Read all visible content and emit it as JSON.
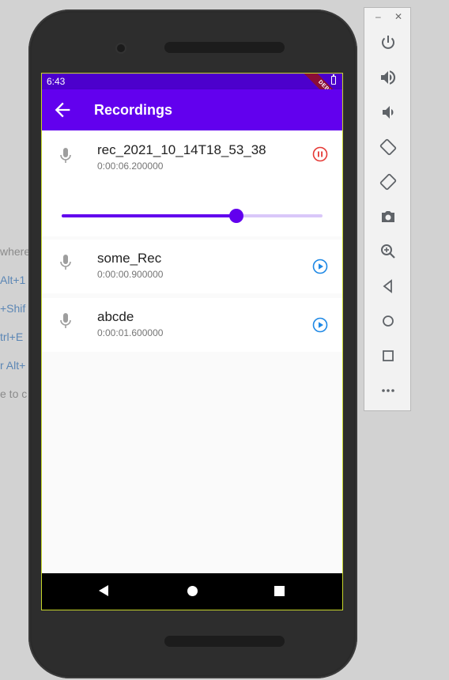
{
  "background_hints": [
    "where",
    "Alt+1",
    "+Shif",
    "trl+E",
    "r Alt+",
    "e to c"
  ],
  "status_bar": {
    "time": "6:43",
    "debug_label": "DEBUG"
  },
  "app_bar": {
    "title": "Recordings"
  },
  "recordings": [
    {
      "name": "rec_2021_10_14T18_53_38",
      "duration": "0:00:06.200000",
      "state": "playing",
      "action_icon": "pause-circle-icon",
      "progress": 0.67
    },
    {
      "name": "some_Rec",
      "duration": "0:00:00.900000",
      "state": "stopped",
      "action_icon": "play-circle-icon"
    },
    {
      "name": "abcde",
      "duration": "0:00:01.600000",
      "state": "stopped",
      "action_icon": "play-circle-icon"
    }
  ],
  "colors": {
    "primary": "#6200ee",
    "status_bar": "#4c00cc",
    "pause": "#e53935",
    "play": "#1e88e5"
  },
  "emulator_panel": {
    "tools": [
      "power-icon",
      "volume-up-icon",
      "volume-down-icon",
      "rotate-left-icon",
      "rotate-right-icon",
      "camera-icon",
      "zoom-icon",
      "back-icon",
      "home-icon",
      "overview-icon",
      "more-icon"
    ]
  }
}
